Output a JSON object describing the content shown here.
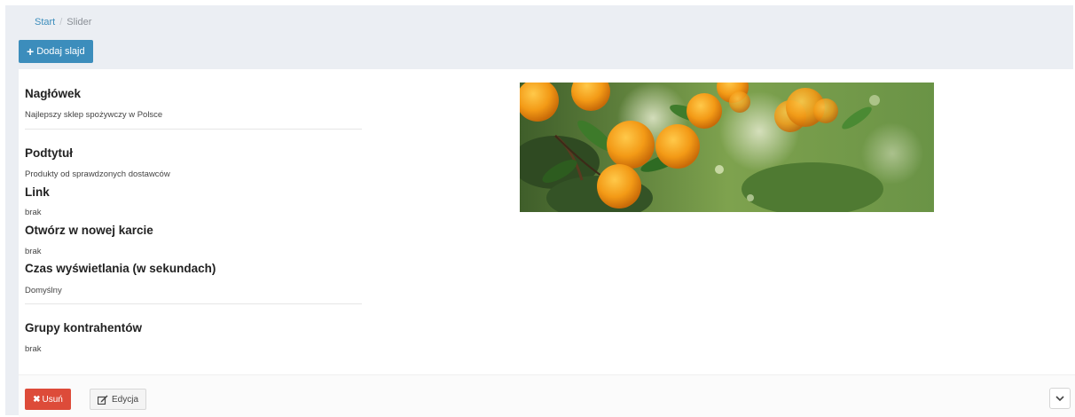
{
  "breadcrumb": {
    "home": "Start",
    "separator": "/",
    "current": "Slider"
  },
  "toolbar": {
    "add_label": "Dodaj slajd",
    "add_icon": "plus-icon"
  },
  "slide": {
    "fields": [
      {
        "label": "Nagłówek",
        "value": "Najlepszy sklep spożywczy w Polsce"
      },
      {
        "label": "Podtytuł",
        "value": "Produkty od sprawdzonych dostawców"
      },
      {
        "label": "Link",
        "value": "brak"
      },
      {
        "label": "Otwórz w nowej karcie",
        "value": "brak"
      },
      {
        "label": "Czas wyświetlania (w sekundach)",
        "value": "Domyślny"
      },
      {
        "label": "Grupy kontrahentów",
        "value": "brak"
      }
    ]
  },
  "actions": {
    "delete_label": "Usuń",
    "delete_icon": "times-icon",
    "edit_label": "Edycja",
    "edit_icon": "edit-icon",
    "expand_icon": "chevron-down-icon"
  },
  "colors": {
    "primary": "#3c8dbc",
    "danger": "#dd4b39",
    "background": "#ebeef3"
  }
}
